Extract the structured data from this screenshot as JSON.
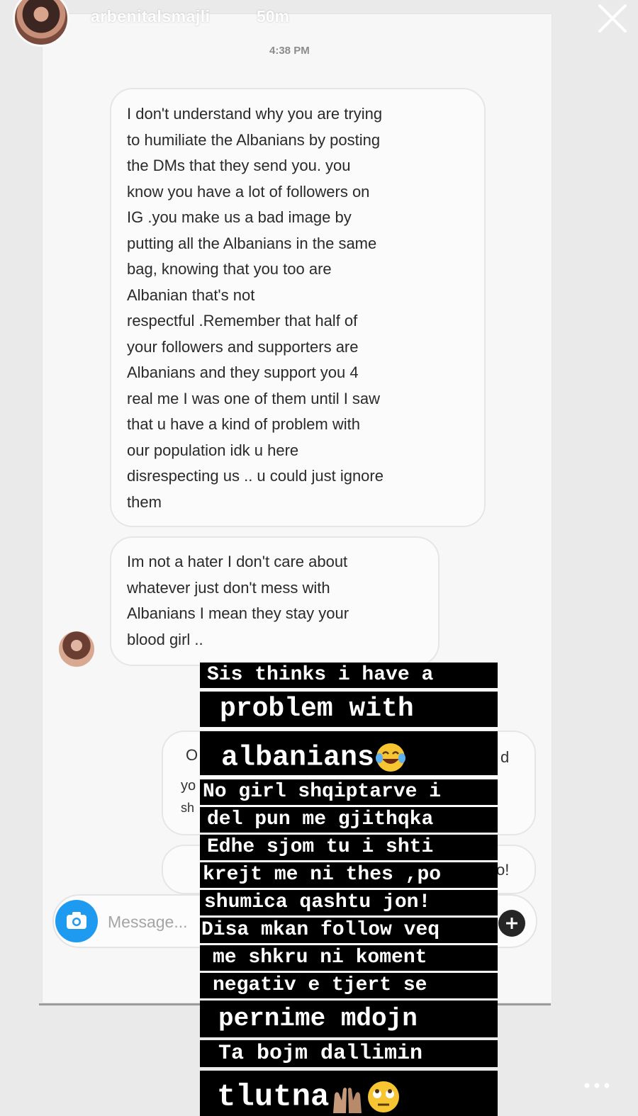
{
  "story": {
    "username": "arbenitalsmajli",
    "time_ago": "50m"
  },
  "dm": {
    "timestamp": "4:38 PM",
    "messages": [
      "I don't understand why you are trying\nto humiliate the Albanians by posting\nthe DMs that they send you. you\nknow you have a lot of followers on\nIG .you make us a bad image by\nputting all the Albanians in the same\nbag, knowing that you too are\nAlbanian that's not\nrespectful .Remember that half of\nyour followers and supporters  are\nAlbanians and they support you 4\nreal me I was one of them until I saw\nthat u have a kind of problem with\nour population idk u here\ndisrespecting us .. u could just ignore\nthem",
      "Im not a hater I don't care about\nwhatever just don't mess with\nAlbanians I mean they stay your\nblood girl .."
    ],
    "reply_fragments": {
      "line1_left": "O",
      "line1_right": "d",
      "line2_left": "yo",
      "line3_left": "sh",
      "bubble2_right": "o!"
    },
    "composer_placeholder": "Message..."
  },
  "sticker_lines": [
    "Sis thinks i have a",
    "problem with",
    "albanians",
    "No girl shqiptarve i",
    "del pun me gjithqka",
    "Edhe sjom tu i shti",
    "krejt me ni thes ,po",
    "shumica qashtu jon!",
    "Disa mkan follow veq",
    "me shkru ni koment",
    "negativ e tjert se",
    "pernime mdojn",
    "Ta bojm dallimin",
    "tlutna"
  ],
  "icons": {
    "close": "close-icon",
    "camera": "camera-icon",
    "plus": "plus-icon",
    "more": "more-icon",
    "emoji_laugh": "face-with-tears-of-joy-icon",
    "emoji_hands": "raised-hands-icon",
    "emoji_eyes": "face-with-rolling-eyes-icon"
  },
  "colors": {
    "camera_blue": "#1e9bf0",
    "sticker_bg": "#000000",
    "sticker_text": "#ffffff"
  }
}
